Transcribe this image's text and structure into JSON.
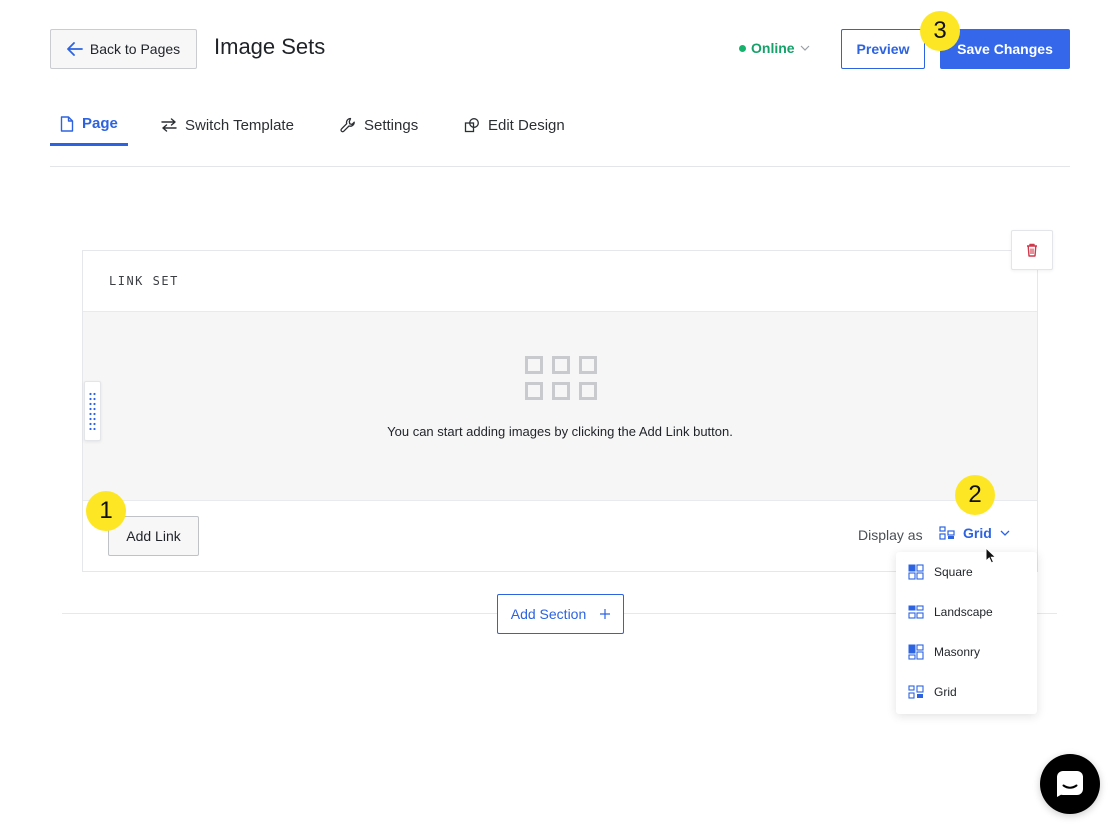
{
  "header": {
    "back_label": "Back to Pages",
    "title": "Image Sets",
    "status_label": "Online",
    "preview_label": "Preview",
    "save_label": "Save Changes"
  },
  "tabs": [
    {
      "label": "Page",
      "active": true
    },
    {
      "label": "Switch Template",
      "active": false
    },
    {
      "label": "Settings",
      "active": false
    },
    {
      "label": "Edit Design",
      "active": false
    }
  ],
  "link_set": {
    "header_label": "LINK SET",
    "empty_message": "You can start adding images by clicking the Add Link button.",
    "add_link_label": "Add Link",
    "display_as_label": "Display as",
    "display_value": "Grid",
    "options": [
      "Square",
      "Landscape",
      "Masonry",
      "Grid"
    ]
  },
  "add_section_label": "Add Section",
  "badges": [
    "1",
    "2",
    "3"
  ],
  "colors": {
    "accent": "#2d63e0",
    "save_button": "#3467ea",
    "online": "#18a06b",
    "badge": "#fde725",
    "trash": "#d0384b"
  },
  "icons": {
    "back": "arrow-left-icon",
    "status": "chevron-down-icon",
    "tab_page": "page-icon",
    "tab_switch": "swap-icon",
    "tab_settings": "wrench-icon",
    "tab_design": "design-shapes-icon",
    "trash": "trash-icon",
    "drag": "drag-handle-icon",
    "empty": "grid-placeholder-icon",
    "chat": "chat-icon"
  }
}
